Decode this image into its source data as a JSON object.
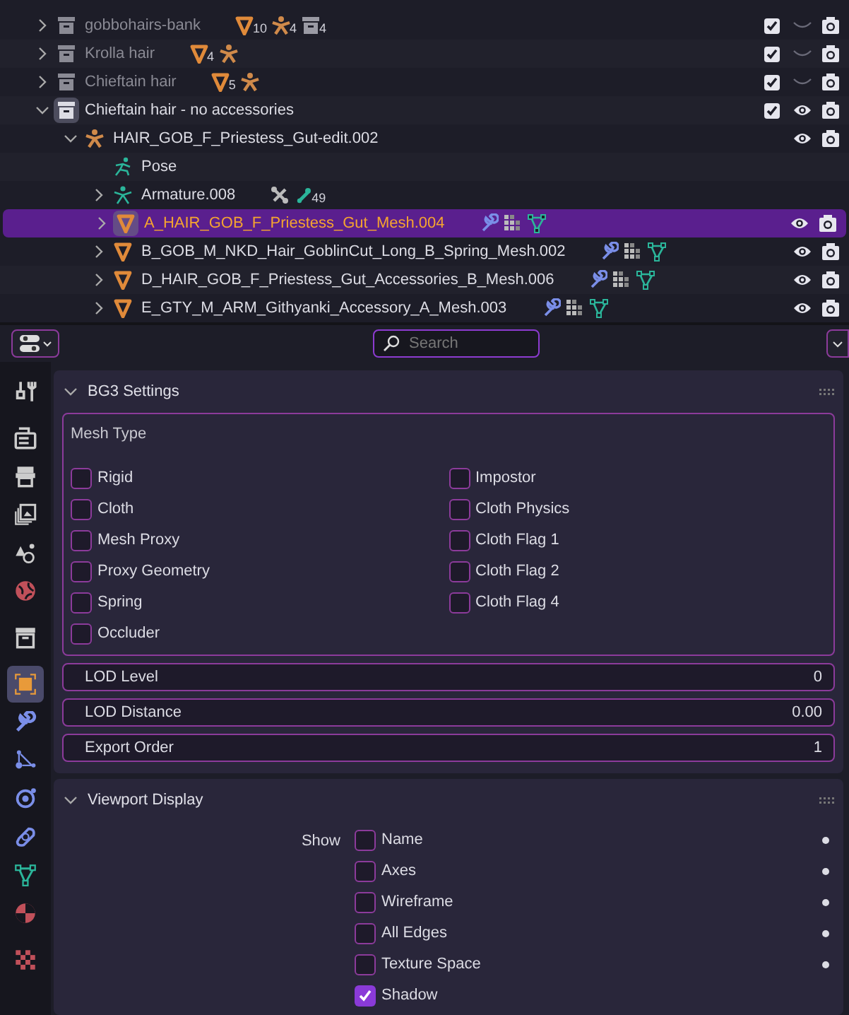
{
  "outliner": {
    "rows": [
      {
        "kind": "collection",
        "name": "gobbohairs-bank",
        "expanded": false,
        "checked": true,
        "visible": false,
        "badges": [
          {
            "kind": "mesh",
            "count": "10"
          },
          {
            "kind": "armature",
            "count": "4"
          },
          {
            "kind": "collection",
            "count": "4"
          }
        ]
      },
      {
        "kind": "collection",
        "name": "Krolla hair",
        "expanded": false,
        "checked": true,
        "visible": false,
        "badges": [
          {
            "kind": "mesh",
            "count": "4"
          },
          {
            "kind": "armature"
          }
        ]
      },
      {
        "kind": "collection",
        "name": "Chieftain hair",
        "expanded": false,
        "checked": true,
        "visible": false,
        "badges": [
          {
            "kind": "mesh",
            "count": "5"
          },
          {
            "kind": "armature"
          }
        ]
      },
      {
        "kind": "collection",
        "name": "Chieftain hair - no accessories",
        "expanded": true,
        "checked": true,
        "visible": true,
        "children": [
          {
            "kind": "armature",
            "name": "HAIR_GOB_F_Priestess_Gut-edit.002",
            "expanded": true,
            "visible": true,
            "children": [
              {
                "kind": "pose",
                "name": "Pose"
              },
              {
                "kind": "armature_data",
                "name": "Armature.008",
                "expanded": false,
                "badges": [
                  {
                    "kind": "constraint"
                  },
                  {
                    "kind": "bone",
                    "count": "49"
                  }
                ]
              },
              {
                "kind": "mesh",
                "name": "A_HAIR_GOB_F_Priestess_Gut_Mesh.004",
                "expanded": false,
                "selected": true,
                "visible": true,
                "badges": [
                  {
                    "kind": "modifier"
                  },
                  {
                    "kind": "vertex_groups"
                  },
                  {
                    "kind": "mesh_data"
                  }
                ]
              },
              {
                "kind": "mesh",
                "name": "B_GOB_M_NKD_Hair_GoblinCut_Long_B_Spring_Mesh.002",
                "expanded": false,
                "selected": false,
                "visible": true,
                "badges": [
                  {
                    "kind": "modifier"
                  },
                  {
                    "kind": "vertex_groups"
                  },
                  {
                    "kind": "mesh_data"
                  }
                ]
              },
              {
                "kind": "mesh",
                "name": "D_HAIR_GOB_F_Priestess_Gut_Accessories_B_Mesh.006",
                "expanded": false,
                "selected": false,
                "visible": true,
                "badges": [
                  {
                    "kind": "modifier"
                  },
                  {
                    "kind": "vertex_groups"
                  },
                  {
                    "kind": "mesh_data"
                  }
                ]
              },
              {
                "kind": "mesh",
                "name": "E_GTY_M_ARM_Githyanki_Accessory_A_Mesh.003",
                "expanded": false,
                "selected": false,
                "visible": true,
                "badges": [
                  {
                    "kind": "modifier"
                  },
                  {
                    "kind": "vertex_groups"
                  },
                  {
                    "kind": "mesh_data"
                  }
                ]
              }
            ]
          }
        ]
      }
    ]
  },
  "properties": {
    "search": {
      "placeholder": "Search"
    },
    "tabs": [
      {
        "kind": "tool",
        "selected": false
      },
      {
        "kind": "render",
        "selected": false
      },
      {
        "kind": "output",
        "selected": false
      },
      {
        "kind": "view_layer",
        "selected": false
      },
      {
        "kind": "scene",
        "selected": false
      },
      {
        "kind": "world",
        "selected": false
      },
      {
        "kind": "collection",
        "selected": false
      },
      {
        "kind": "object",
        "selected": true
      },
      {
        "kind": "modifiers",
        "selected": false
      },
      {
        "kind": "particles",
        "selected": false
      },
      {
        "kind": "physics",
        "selected": false
      },
      {
        "kind": "constraints",
        "selected": false
      },
      {
        "kind": "data",
        "selected": false
      },
      {
        "kind": "material",
        "selected": false
      },
      {
        "kind": "texture",
        "selected": false
      }
    ],
    "panels": [
      {
        "kind": "bg3",
        "title": "BG3 Settings",
        "expanded": true,
        "mesh_type": {
          "label": "Mesh Type",
          "columns": [
            [
              {
                "label": "Rigid",
                "checked": false
              },
              {
                "label": "Cloth",
                "checked": false
              },
              {
                "label": "Mesh Proxy",
                "checked": false
              },
              {
                "label": "Proxy Geometry",
                "checked": false
              },
              {
                "label": "Spring",
                "checked": false
              },
              {
                "label": "Occluder",
                "checked": false
              }
            ],
            [
              {
                "label": "Impostor",
                "checked": false
              },
              {
                "label": "Cloth Physics",
                "checked": false
              },
              {
                "label": "Cloth Flag 1",
                "checked": false
              },
              {
                "label": "Cloth Flag 2",
                "checked": false
              },
              {
                "label": "Cloth Flag 4",
                "checked": false
              }
            ]
          ]
        },
        "fields": [
          {
            "label": "LOD Level",
            "value": "0"
          },
          {
            "label": "LOD Distance",
            "value": "0.00"
          },
          {
            "label": "Export Order",
            "value": "1"
          }
        ]
      },
      {
        "kind": "viewport",
        "title": "Viewport Display",
        "expanded": true,
        "show_label": "Show",
        "options": [
          {
            "label": "Name",
            "checked": false
          },
          {
            "label": "Axes",
            "checked": false
          },
          {
            "label": "Wireframe",
            "checked": false
          },
          {
            "label": "All Edges",
            "checked": false
          },
          {
            "label": "Texture Space",
            "checked": false
          },
          {
            "label": "Shadow",
            "checked": true
          }
        ]
      }
    ]
  }
}
